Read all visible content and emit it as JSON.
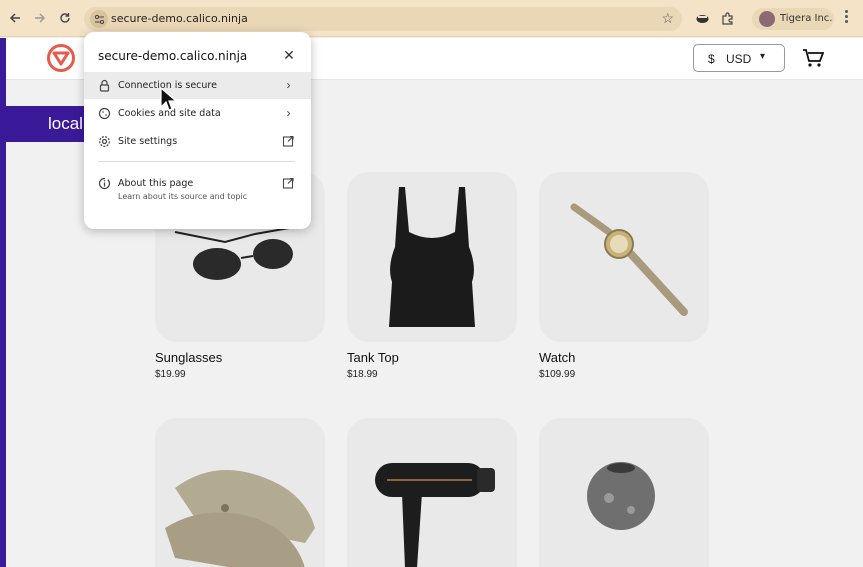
{
  "browser": {
    "url": "secure-demo.calico.ninja",
    "profile_name": "Tigera Inc.",
    "toolbar_color": "#f5e3c7"
  },
  "site": {
    "currency_symbol": "$",
    "currency_code": "USD",
    "banner_text": "local",
    "brand_color": "#3b1a9a",
    "logo_color": "#e85b4a"
  },
  "products": [
    {
      "name": "Sunglasses",
      "price": "$19.99",
      "image": "sunglasses"
    },
    {
      "name": "Tank Top",
      "price": "$18.99",
      "image": "tank-top"
    },
    {
      "name": "Watch",
      "price": "$109.99",
      "image": "watch"
    },
    {
      "name": "",
      "price": "",
      "image": "loafers"
    },
    {
      "name": "",
      "price": "",
      "image": "hair-dryer"
    },
    {
      "name": "",
      "price": "",
      "image": "candle-holder"
    }
  ],
  "site_info_popup": {
    "title": "secure-demo.calico.ninja",
    "items": [
      {
        "label": "Connection is secure",
        "icon": "lock-icon",
        "end_icon": "chevron-right-icon"
      },
      {
        "label": "Cookies and site data",
        "icon": "cookie-icon",
        "end_icon": "chevron-right-icon"
      },
      {
        "label": "Site settings",
        "icon": "gear-icon",
        "end_icon": "open-external-icon"
      }
    ],
    "about": {
      "label": "About this page",
      "subtitle": "Learn about its source and topic"
    }
  }
}
